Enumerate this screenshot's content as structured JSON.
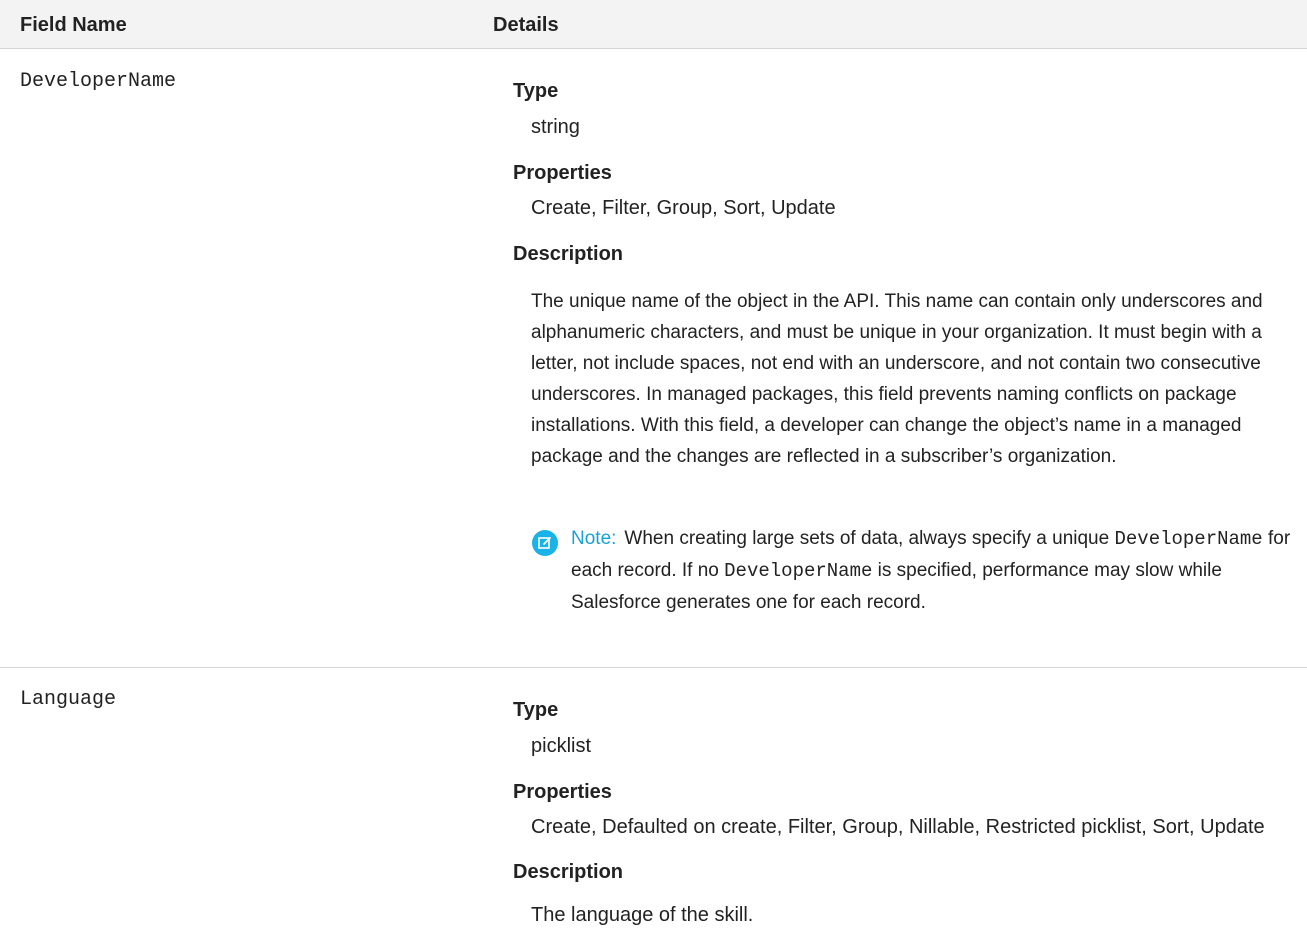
{
  "table": {
    "header_field": "Field Name",
    "header_details": "Details"
  },
  "rows": [
    {
      "field": "DeveloperName",
      "type_label": "Type",
      "type_value": "string",
      "properties_label": "Properties",
      "properties_value": "Create, Filter, Group, Sort, Update",
      "description_label": "Description",
      "description_text": "The unique name of the object in the API. This name can contain only underscores and alphanumeric characters, and must be unique in your organization. It must begin with a letter, not include spaces, not end with an underscore, and not contain two consecutive underscores. In managed packages, this field prevents naming conflicts on package installations. With this field, a developer can change the object’s name in a managed package and the changes are reflected in a subscriber’s organization.",
      "note": {
        "icon": "edit-note-icon",
        "label": "Note:",
        "text_1": "When creating large sets of data, always specify a unique",
        "code_1": "DeveloperName",
        "text_2": "for each record. If no",
        "code_2": "DeveloperName",
        "text_3": "is specified, performance may slow while Salesforce generates one for each record."
      }
    },
    {
      "field": "Language",
      "type_label": "Type",
      "type_value": "picklist",
      "properties_label": "Properties",
      "properties_value": "Create, Defaulted on create, Filter, Group, Nillable, Restricted picklist, Sort, Update",
      "description_label": "Description",
      "description_text": "The language of the skill."
    }
  ]
}
